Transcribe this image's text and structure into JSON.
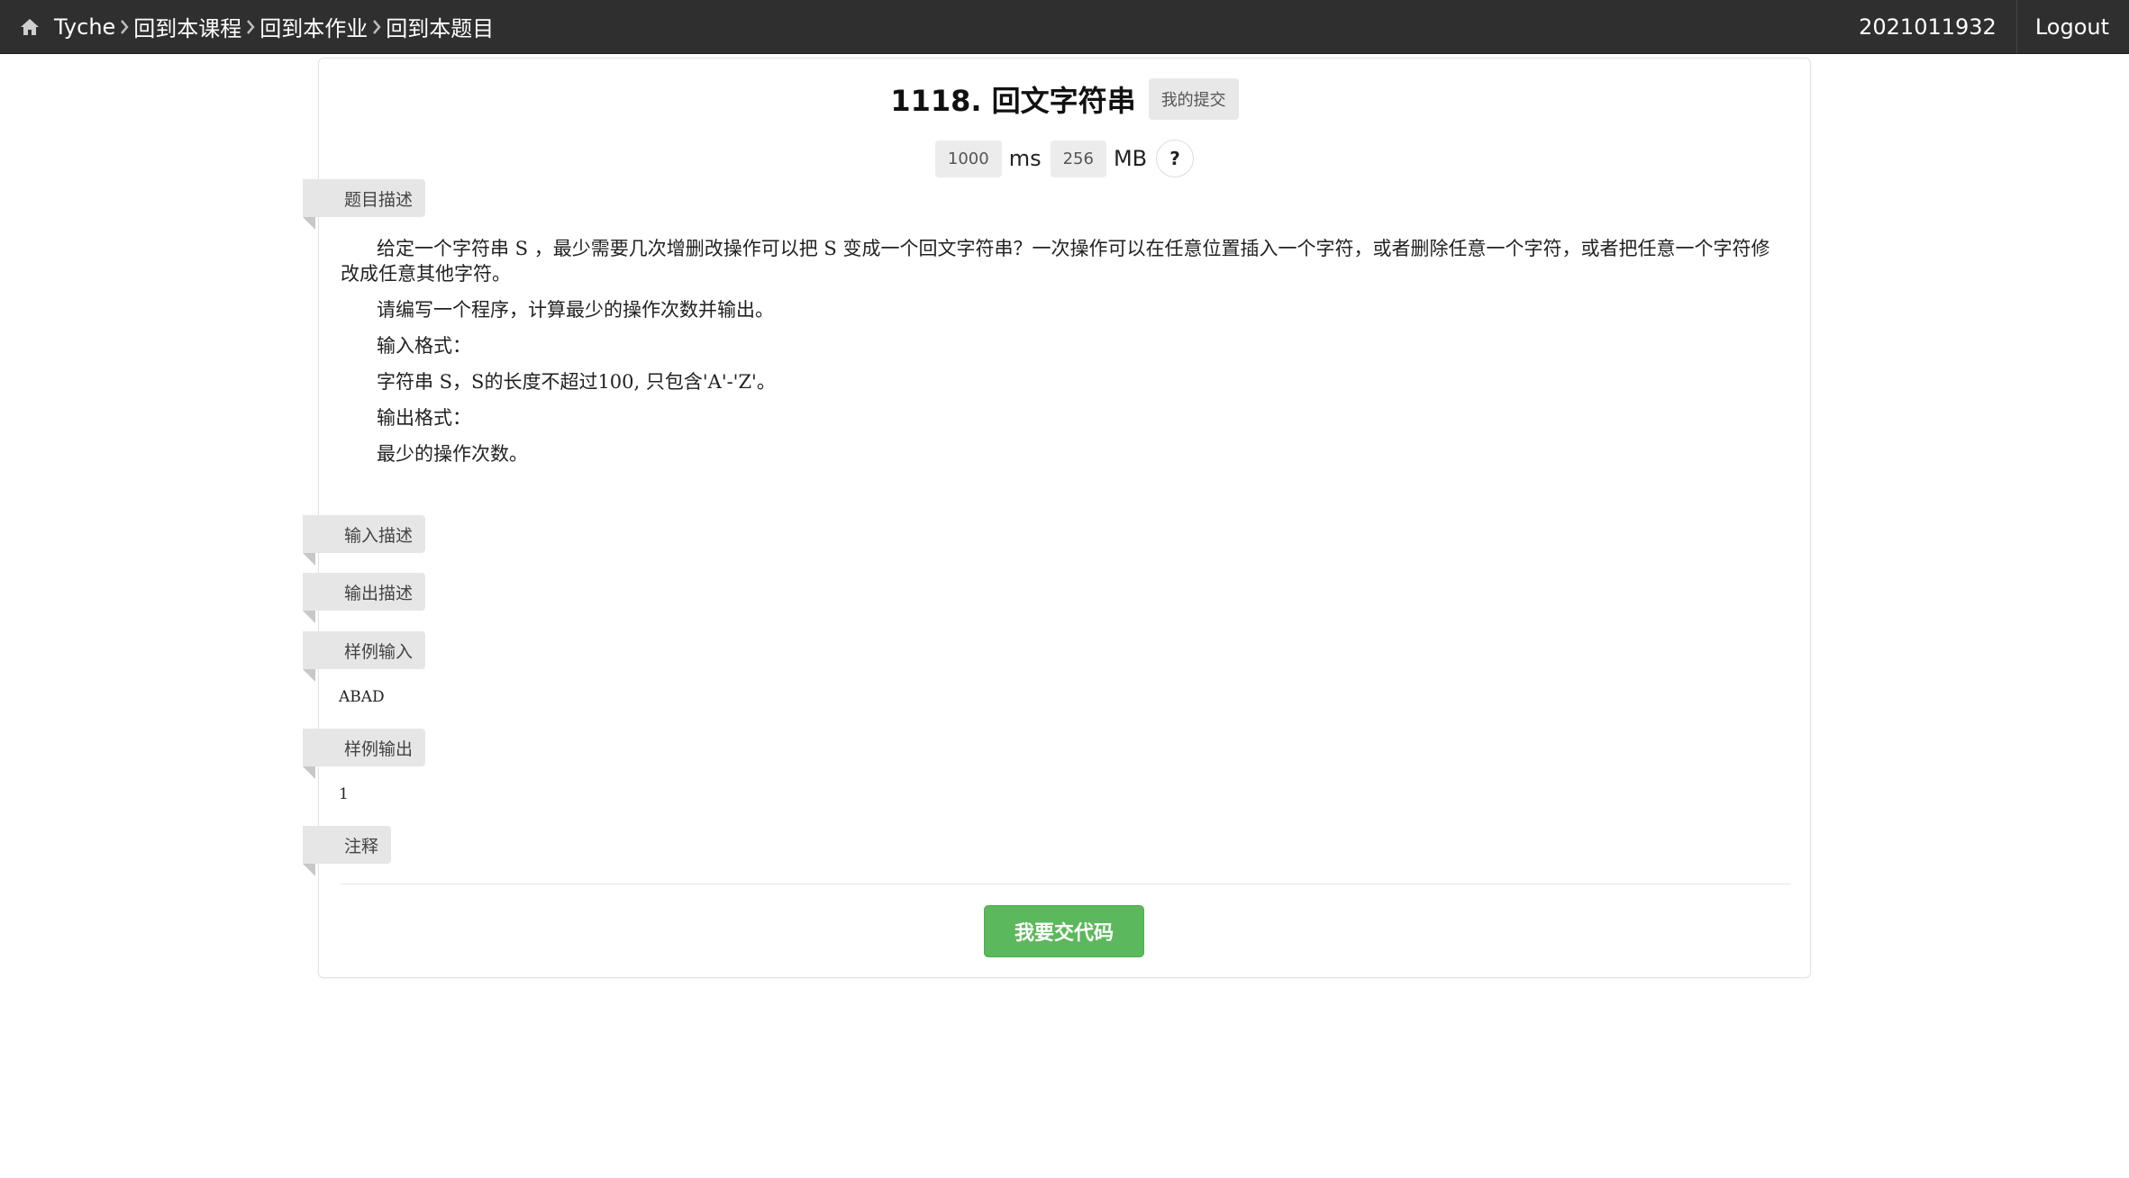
{
  "nav": {
    "brand": "Tyche",
    "breadcrumbs": [
      "回到本课程",
      "回到本作业",
      "回到本题目"
    ],
    "user": "2021011932",
    "logout": "Logout"
  },
  "problem": {
    "title": "1118. 回文字符串",
    "my_submissions": "我的提交",
    "time_limit": "1000",
    "time_unit": "ms",
    "memory_limit": "256",
    "memory_unit": "MB",
    "help": "?"
  },
  "sections": {
    "description": "题目描述",
    "input": "输入描述",
    "output": "输出描述",
    "sample_input": "样例输入",
    "sample_output": "样例输出",
    "notes": "注释"
  },
  "description_paragraphs": [
    "给定一个字符串 S ，最少需要几次增删改操作可以把 S 变成一个回文字符串？一次操作可以在任意位置插入一个字符，或者删除任意一个字符，或者把任意一个字符修改成任意其他字符。",
    "请编写一个程序，计算最少的操作次数并输出。",
    "输入格式：",
    "字符串 S，S的长度不超过100, 只包含'A'-'Z'。",
    "输出格式：",
    "最少的操作次数。"
  ],
  "samples": {
    "input": "ABAD",
    "output": "1"
  },
  "submit_button": "我要交代码",
  "colors": {
    "navbar_bg": "#2f2f2f",
    "ribbon_bg": "#e6e6e6",
    "submit_green": "#5cb85c"
  }
}
